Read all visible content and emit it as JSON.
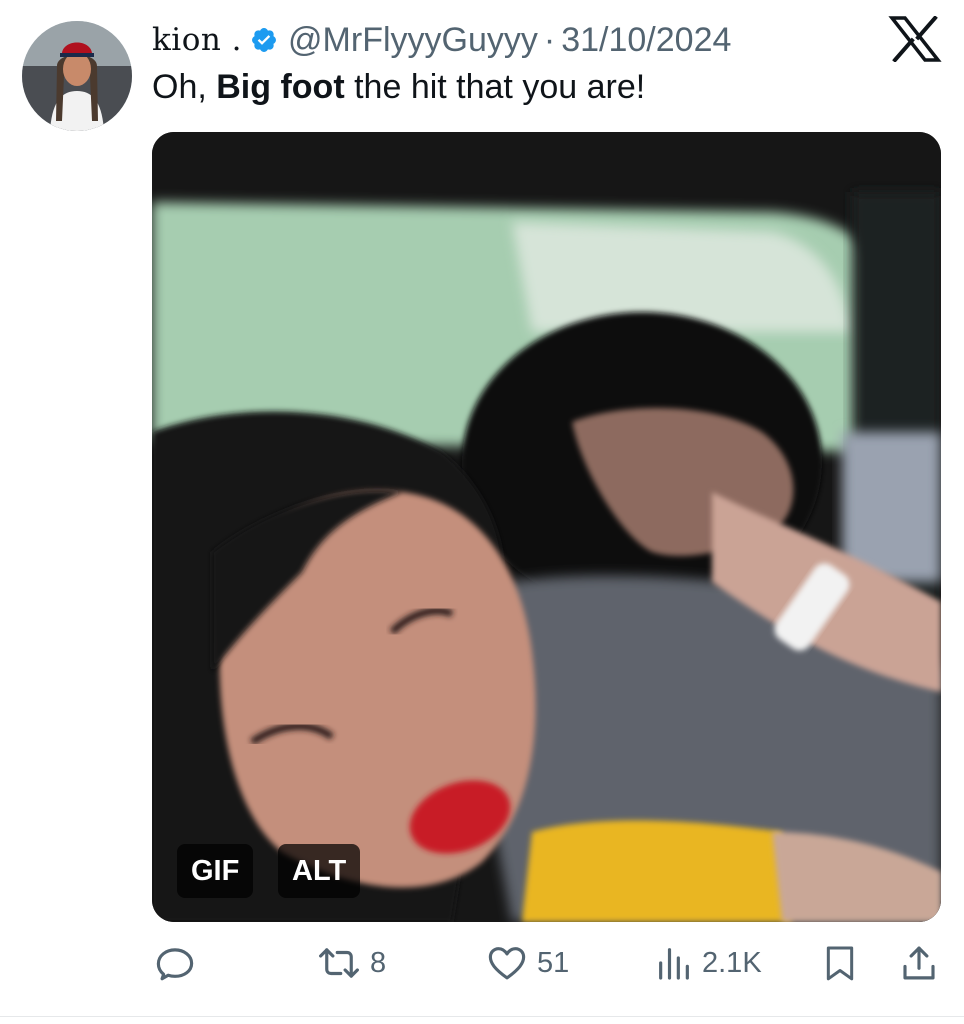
{
  "author": {
    "display_name": "kion .",
    "handle": "@MrFlyyyGuyyy",
    "separator": "·",
    "date": "31/10/2024"
  },
  "tweet": {
    "text_before": "Oh, ",
    "text_bold": "Big foot",
    "text_after": " the hit that you are!"
  },
  "media": {
    "gif_badge": "GIF",
    "alt_badge": "ALT"
  },
  "actions": {
    "reply_count": "",
    "retweet_count": "8",
    "like_count": "51",
    "views_count": "2.1K"
  },
  "icons": {
    "verified": "verified-badge-icon",
    "logo": "x-logo-icon",
    "reply": "reply-icon",
    "retweet": "retweet-icon",
    "like": "heart-icon",
    "views": "views-icon",
    "bookmark": "bookmark-icon",
    "share": "share-icon"
  },
  "colors": {
    "verified": "#1d9bf0",
    "text": "#0f1419",
    "secondary_text": "#536471"
  }
}
